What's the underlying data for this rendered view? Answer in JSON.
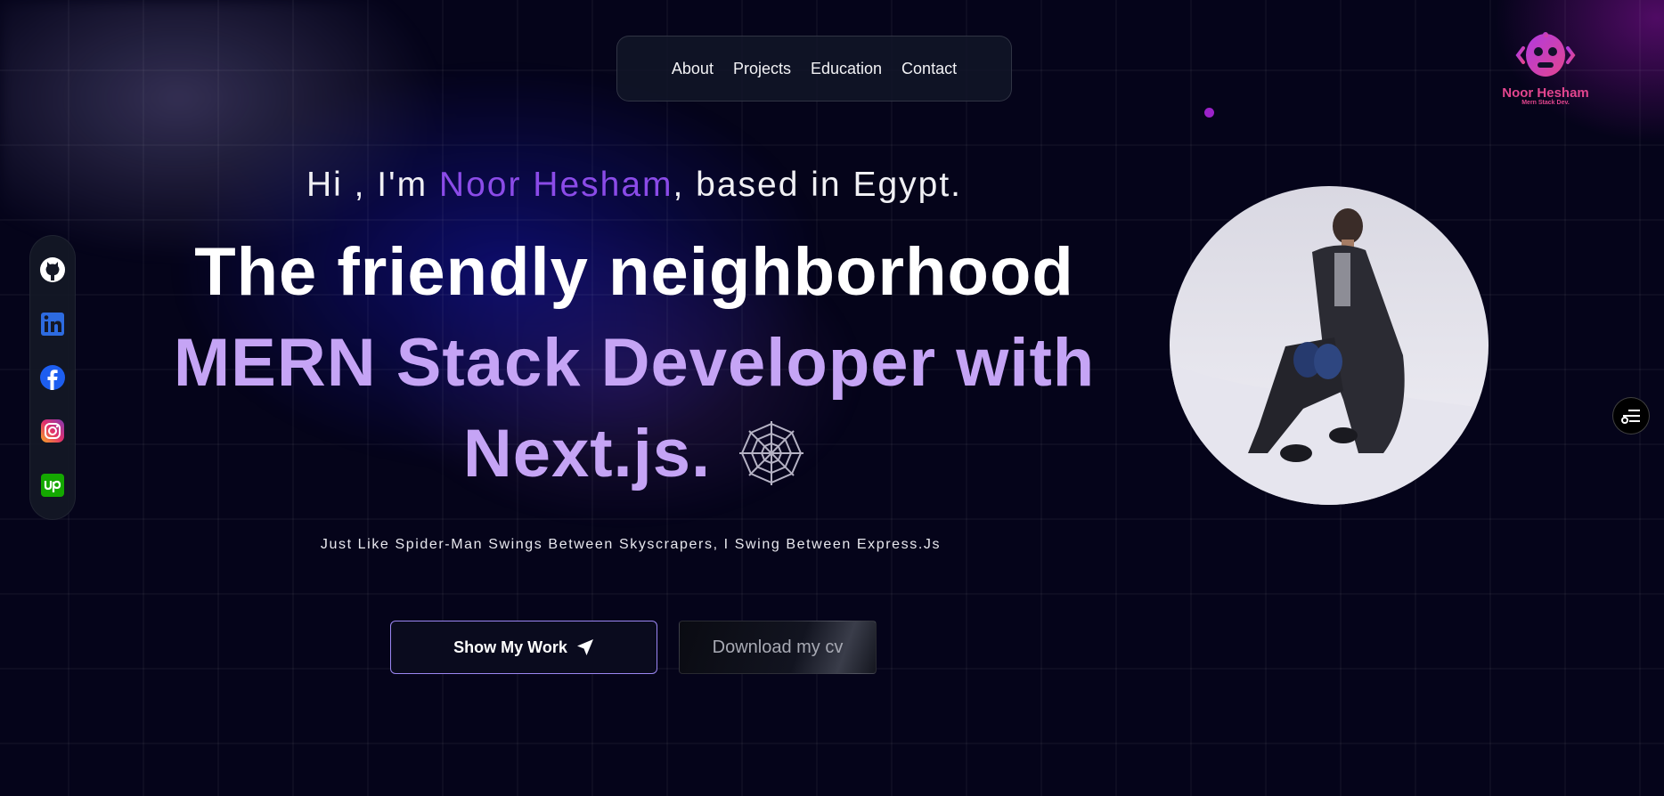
{
  "nav": {
    "items": [
      {
        "label": "About"
      },
      {
        "label": "Projects"
      },
      {
        "label": "Education"
      },
      {
        "label": "Contact"
      }
    ]
  },
  "logo": {
    "name": "Noor Hesham",
    "subtitle": "Mern Stack Dev."
  },
  "social": [
    "github-icon",
    "linkedin-icon",
    "facebook-icon",
    "instagram-icon",
    "upwork-icon"
  ],
  "hero": {
    "greeting_prefix": "Hi , I'm ",
    "greeting_name": "Noor Hesham",
    "greeting_suffix": ", based in Egypt.",
    "line1": "The friendly neighborhood",
    "line2": "MERN Stack Developer with",
    "line3": "Next.js.",
    "tagline": "Just Like Spider-Man Swings Between Skyscrapers, I Swing Between Express.Js"
  },
  "buttons": {
    "primary": "Show My Work",
    "secondary": "Download my cv"
  },
  "colors": {
    "background": "#05041a",
    "accent_name": "#8b4be8",
    "headline_accent": "#c5a4f5",
    "logo": "#e2458e"
  }
}
